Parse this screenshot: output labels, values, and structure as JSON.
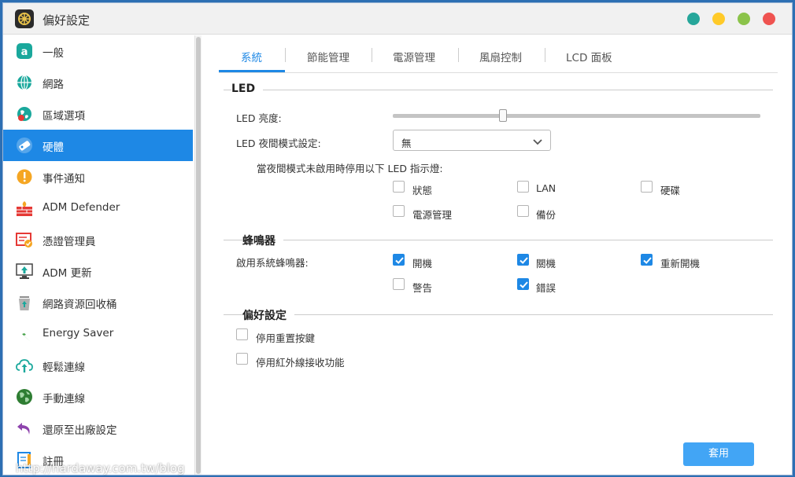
{
  "window": {
    "title": "偏好設定"
  },
  "window_controls": [
    "#26a69a",
    "#ffca28",
    "#8bc34a",
    "#ef5350"
  ],
  "sidebar": {
    "items": [
      {
        "label": "一般",
        "icon": "general-icon"
      },
      {
        "label": "網路",
        "icon": "globe-icon"
      },
      {
        "label": "區域選項",
        "icon": "region-icon"
      },
      {
        "label": "硬體",
        "icon": "hardware-icon",
        "active": true
      },
      {
        "label": "事件通知",
        "icon": "alert-icon"
      },
      {
        "label": "ADM Defender",
        "icon": "firewall-icon"
      },
      {
        "label": "憑證管理員",
        "icon": "certificate-icon"
      },
      {
        "label": "ADM 更新",
        "icon": "update-icon"
      },
      {
        "label": "網路資源回收桶",
        "icon": "recycle-icon"
      },
      {
        "label": "Energy Saver",
        "icon": "energy-icon"
      },
      {
        "label": "輕鬆連線",
        "icon": "cloud-icon"
      },
      {
        "label": "手動連線",
        "icon": "manual-connect-icon"
      },
      {
        "label": "還原至出廠設定",
        "icon": "restore-icon"
      },
      {
        "label": "註冊",
        "icon": "register-icon"
      }
    ]
  },
  "tabs": [
    {
      "label": "系統",
      "active": true
    },
    {
      "label": "節能管理"
    },
    {
      "label": "電源管理"
    },
    {
      "label": "風扇控制"
    },
    {
      "label": "LCD 面板"
    }
  ],
  "led": {
    "section_title": "LED",
    "brightness_label": "LED 亮度:",
    "brightness_level": 0.3,
    "night_mode_label": "LED 夜間模式設定:",
    "night_mode_value": "無",
    "disable_note": "當夜間模式未啟用時停用以下 LED 指示燈:",
    "indicators": [
      {
        "label": "狀態",
        "checked": false
      },
      {
        "label": "LAN",
        "checked": false
      },
      {
        "label": "硬碟",
        "checked": false
      },
      {
        "label": "電源管理",
        "checked": false
      },
      {
        "label": "備份",
        "checked": false
      }
    ]
  },
  "buzzer": {
    "section_title": "蜂鳴器",
    "enable_label": "啟用系統蜂鳴器:",
    "options": [
      {
        "label": "開機",
        "checked": true
      },
      {
        "label": "關機",
        "checked": true
      },
      {
        "label": "重新開機",
        "checked": true
      },
      {
        "label": "警告",
        "checked": false
      },
      {
        "label": "錯誤",
        "checked": true
      }
    ]
  },
  "preferences": {
    "section_title": "偏好設定",
    "options": [
      {
        "label": "停用重置按鍵",
        "checked": false
      },
      {
        "label": "停用紅外線接收功能",
        "checked": false
      }
    ]
  },
  "apply_label": "套用",
  "watermark": "http://hardaway.com.tw/blog",
  "accent_color": "#1e88e5"
}
